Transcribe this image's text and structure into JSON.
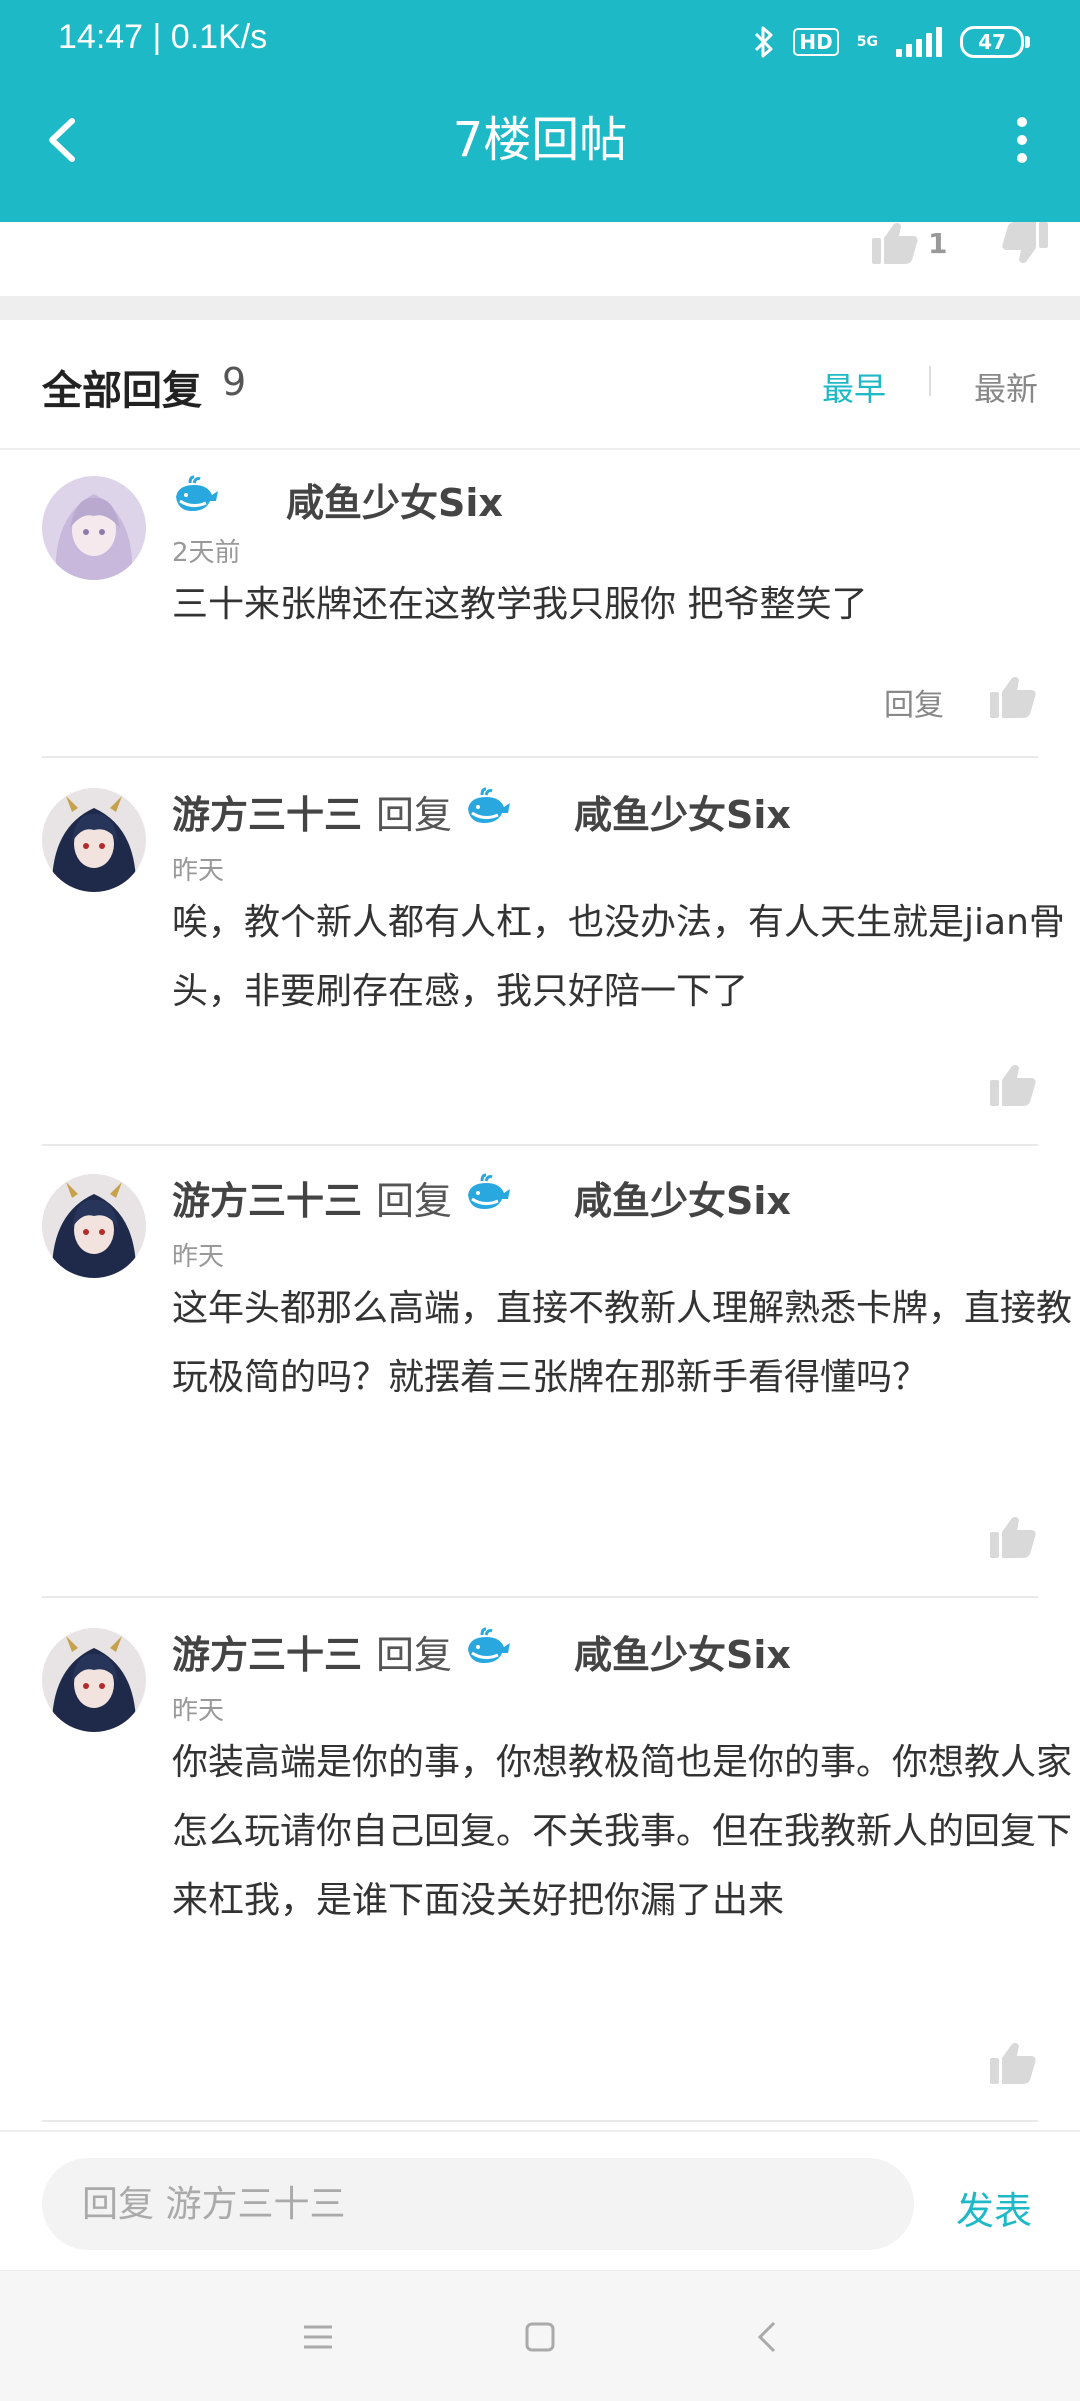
{
  "status_bar": {
    "time_speed": "14:47 | 0.1K/s",
    "hd": "HD",
    "network": "5G",
    "battery": "47"
  },
  "header": {
    "title": "7楼回帖"
  },
  "vote": {
    "up_count": "1"
  },
  "replies_header": {
    "title": "全部回复",
    "count": "9",
    "sort_earliest": "最早",
    "sort_latest": "最新"
  },
  "replies": [
    {
      "author": "",
      "target": "咸鱼少女Six",
      "time": "2天前",
      "text": "三十来张牌还在这教学我只服你 把爷整笑了",
      "reply_label": "回复"
    },
    {
      "author": "游方三十三",
      "reply_word": "回复",
      "target": "咸鱼少女Six",
      "time": "昨天",
      "text": "唉，教个新人都有人杠，也没办法，有人天生就是jian骨头，非要刷存在感，我只好陪一下了"
    },
    {
      "author": "游方三十三",
      "reply_word": "回复",
      "target": "咸鱼少女Six",
      "time": "昨天",
      "text": "这年头都那么高端，直接不教新人理解熟悉卡牌，直接教玩极简的吗？就摆着三张牌在那新手看得懂吗？"
    },
    {
      "author": "游方三十三",
      "reply_word": "回复",
      "target": "咸鱼少女Six",
      "time": "昨天",
      "text": "你装高端是你的事，你想教极简也是你的事。你想教人家怎么玩请你自己回复。不关我事。但在我教新人的回复下来杠我，是谁下面没关好把你漏了出来"
    }
  ],
  "input_bar": {
    "placeholder": "回复 游方三十三",
    "submit_label": "发表"
  },
  "colors": {
    "accent": "#1eb9c6",
    "text": "#333333",
    "muted": "#999999"
  }
}
